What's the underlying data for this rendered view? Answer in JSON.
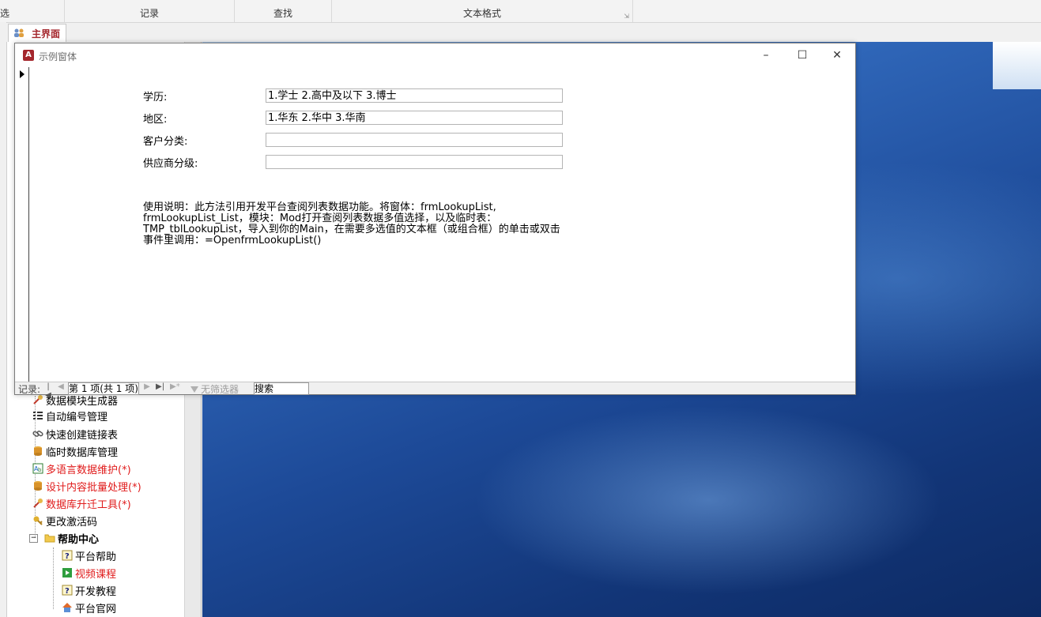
{
  "ribbon": {
    "groups": [
      {
        "label": "选"
      },
      {
        "label": "记录"
      },
      {
        "label": "查找"
      },
      {
        "label": "文本格式"
      }
    ]
  },
  "tab": {
    "label": "主界面"
  },
  "form": {
    "title": "示例窗体",
    "fields": [
      {
        "label": "学历:",
        "value": "1.学士   2.高中及以下   3.博士"
      },
      {
        "label": "地区:",
        "value": "1.华东   2.华中   3.华南"
      },
      {
        "label": "客户分类:",
        "value": ""
      },
      {
        "label": "供应商分级:",
        "value": ""
      }
    ],
    "note": "使用说明：此方法引用开发平台查阅列表数据功能。将窗体：frmLookupList, frmLookupList_List，模块：Mod打开查阅列表数据多值选择，以及临时表：TMP_tblLookupList，导入到你的Main，在需要多选值的文本框（或组合框）的单击或双击事件里调用：=OpenfrmLookupList()"
  },
  "record_nav": {
    "label": "记录:",
    "position": "第 1 项(共 1 项)",
    "filter": "无筛选器",
    "search": "搜索"
  },
  "nav": {
    "items": [
      {
        "label": "数据模块生成器",
        "red": false,
        "icon": "tools-icon"
      },
      {
        "label": "自动编号管理",
        "red": false,
        "icon": "list-icon"
      },
      {
        "label": "快速创建链接表",
        "red": false,
        "icon": "link-icon"
      },
      {
        "label": "临时数据库管理",
        "red": false,
        "icon": "database-icon"
      },
      {
        "label": "多语言数据维护(*)",
        "red": true,
        "icon": "language-icon"
      },
      {
        "label": "设计内容批量处理(*)",
        "red": true,
        "icon": "database-icon"
      },
      {
        "label": "数据库升迁工具(*)",
        "red": true,
        "icon": "tools-icon"
      },
      {
        "label": "更改激活码",
        "red": false,
        "icon": "key-icon"
      }
    ],
    "help_group": "帮助中心",
    "help_items": [
      {
        "label": "平台帮助",
        "red": false,
        "icon": "help-icon"
      },
      {
        "label": "视频课程",
        "red": true,
        "icon": "play-icon"
      },
      {
        "label": "开发教程",
        "red": false,
        "icon": "help-icon"
      },
      {
        "label": "平台官网",
        "red": false,
        "icon": "home-icon"
      }
    ]
  },
  "colors": {
    "accent": "#a4262c",
    "red_text": "#e01b1b"
  }
}
